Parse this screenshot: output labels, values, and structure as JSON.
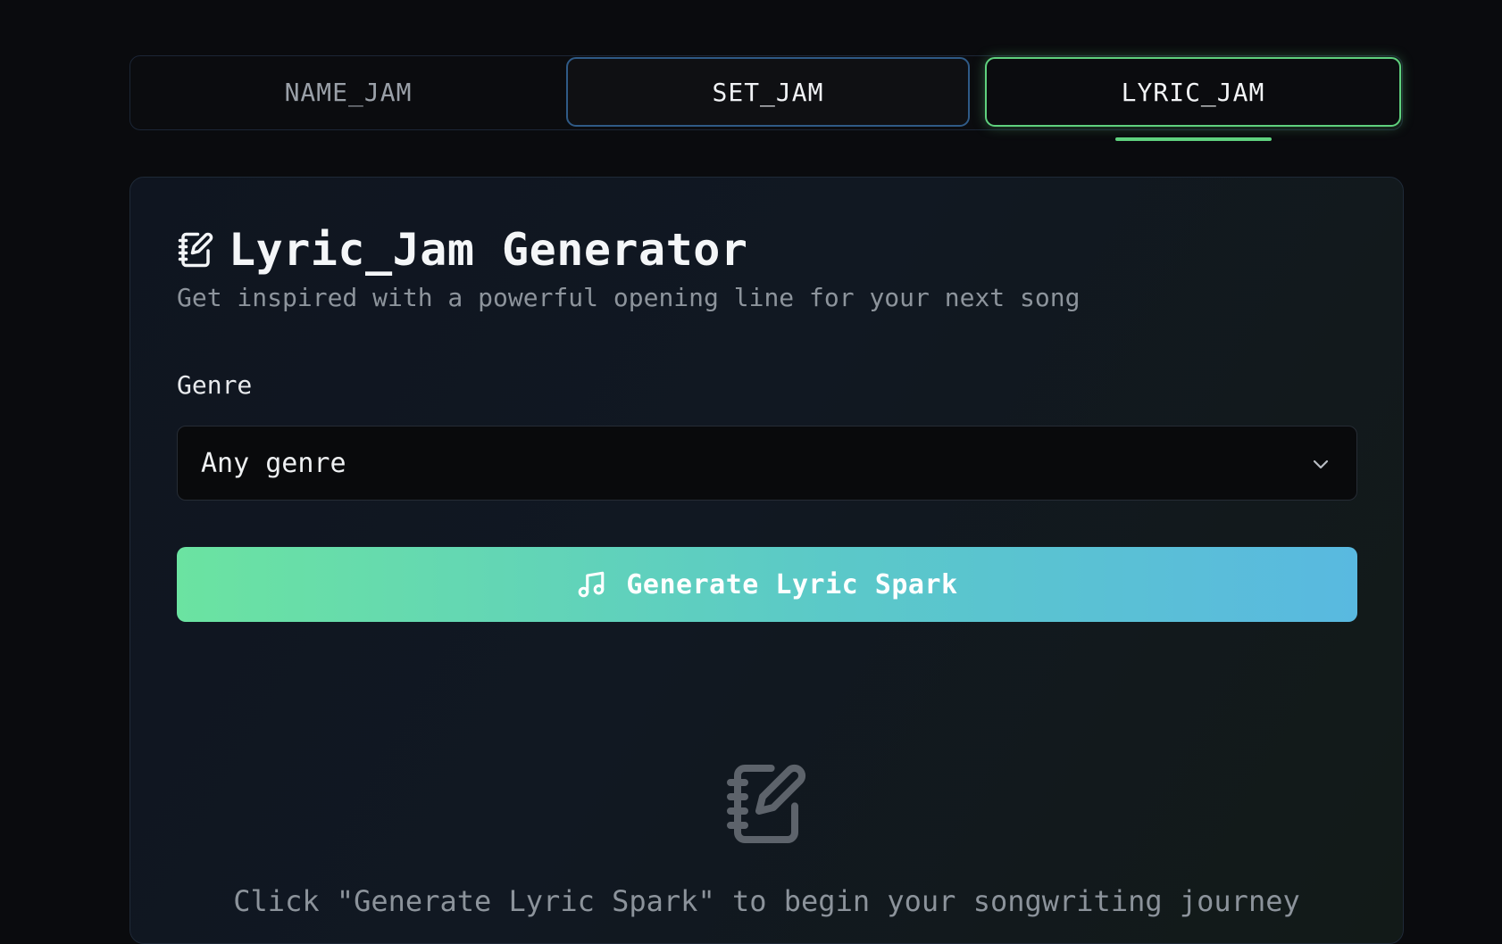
{
  "tabs": [
    {
      "label": "NAME_JAM"
    },
    {
      "label": "SET_JAM"
    },
    {
      "label": "LYRIC_JAM"
    }
  ],
  "active_tab": "LYRIC_JAM",
  "panel": {
    "icon": "notebook-pen-icon",
    "title": "Lyric_Jam Generator",
    "subtitle": "Get inspired with a powerful opening line for your next song",
    "genre": {
      "label": "Genre",
      "selected": "Any genre",
      "icon": "chevron-down-icon"
    },
    "generate_button": {
      "icon": "music-note-icon",
      "label": "Generate Lyric Spark"
    },
    "empty_state": {
      "icon": "notebook-pen-icon",
      "text": "Click \"Generate Lyric Spark\" to begin your songwriting journey"
    }
  },
  "colors": {
    "background": "#0a0b0e",
    "accent_green": "#5fd17e",
    "accent_blue": "#2f5a86",
    "button_gradient_start": "#6be3a1",
    "button_gradient_end": "#59b9e0"
  }
}
